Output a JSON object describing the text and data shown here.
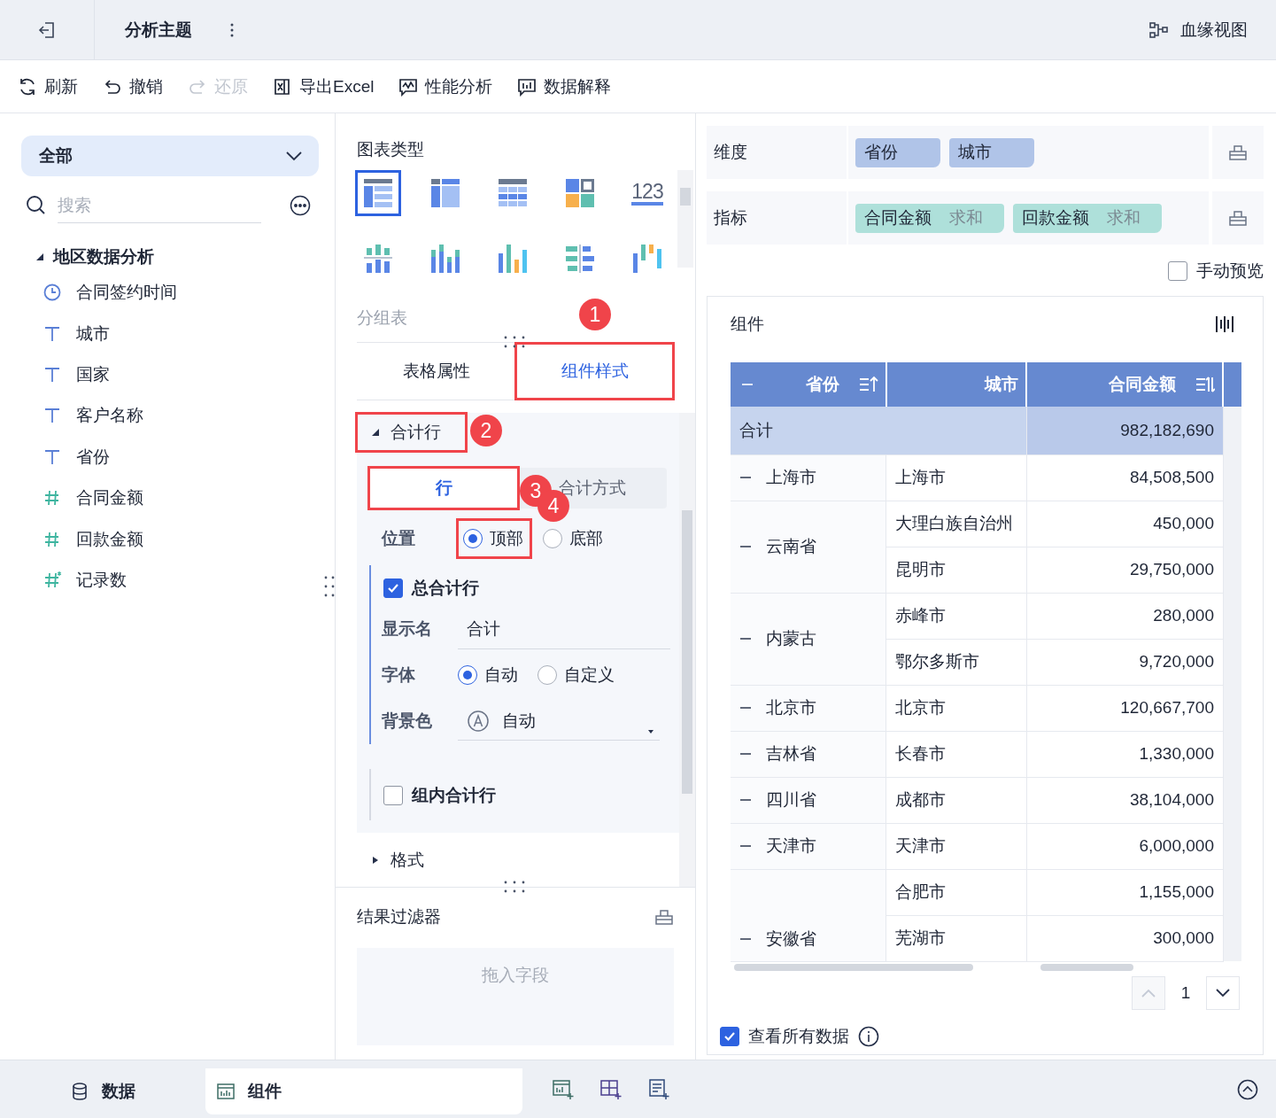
{
  "header": {
    "title": "分析主题",
    "lineage": "血缘视图"
  },
  "toolbar": [
    {
      "kind": "refresh",
      "label": "刷新",
      "disabled": false
    },
    {
      "kind": "undo",
      "label": "撤销",
      "disabled": false
    },
    {
      "kind": "redo",
      "label": "还原",
      "disabled": true
    },
    {
      "kind": "export",
      "label": "导出Excel",
      "disabled": false
    },
    {
      "kind": "performance",
      "label": "性能分析",
      "disabled": false
    },
    {
      "kind": "explain",
      "label": "数据解释",
      "disabled": false
    }
  ],
  "fields": {
    "scope": "全部",
    "search": {
      "placeholder": "搜索"
    },
    "tree": [
      {
        "label": "地区数据分析",
        "expanded": true,
        "children": [
          {
            "kind": "date",
            "label": "合同签约时间"
          },
          {
            "kind": "text",
            "label": "城市"
          },
          {
            "kind": "text",
            "label": "国家"
          },
          {
            "kind": "text",
            "label": "客户名称"
          },
          {
            "kind": "text",
            "label": "省份"
          },
          {
            "kind": "number",
            "label": "合同金额"
          },
          {
            "kind": "number",
            "label": "回款金额"
          },
          {
            "kind": "count",
            "label": "记录数"
          }
        ]
      }
    ]
  },
  "chart": {
    "heading": "图表类型",
    "caption": "分组表",
    "types": [
      {
        "kind": "group-table",
        "selected": true
      },
      {
        "kind": "cross-table",
        "selected": false
      },
      {
        "kind": "detail-table",
        "selected": false
      },
      {
        "kind": "card",
        "selected": false
      },
      {
        "kind": "kpi",
        "label": "123",
        "selected": false
      },
      {
        "kind": "split-bar",
        "selected": false
      },
      {
        "kind": "stacked-column",
        "selected": false
      },
      {
        "kind": "column",
        "selected": false
      },
      {
        "kind": "compare-bar",
        "selected": false
      },
      {
        "kind": "waterfall",
        "selected": false
      }
    ]
  },
  "tabs": [
    {
      "label": "表格属性",
      "selected": false,
      "highlighted": false
    },
    {
      "label": "组件样式",
      "selected": true,
      "highlighted": true,
      "callout": "1"
    }
  ],
  "total_rows": {
    "label": "合计行",
    "expanded": true,
    "highlighted": true,
    "callout": "2",
    "subtabs": [
      {
        "label": "行",
        "selected": true,
        "highlighted": true,
        "callout": "3"
      },
      {
        "label": "合计方式",
        "selected": false,
        "highlighted": false
      }
    ],
    "position": {
      "label": "位置",
      "callout": "4",
      "options": [
        {
          "label": "顶部",
          "selected": true
        },
        {
          "label": "底部",
          "selected": false
        }
      ]
    },
    "grand_total": {
      "label": "总合计行",
      "checked": true,
      "display_name": {
        "label": "显示名",
        "value": "合计"
      },
      "font": {
        "label": "字体",
        "options": [
          {
            "label": "自动",
            "selected": true
          },
          {
            "label": "自定义",
            "selected": false
          }
        ]
      },
      "background": {
        "label": "背景色",
        "value": "自动"
      }
    },
    "group_total": {
      "label": "组内合计行",
      "checked": false
    }
  },
  "format": {
    "label": "格式",
    "expanded": false
  },
  "result_filter": {
    "title": "结果过滤器",
    "placeholder": "拖入字段"
  },
  "dimensions": {
    "label": "维度",
    "chips": [
      {
        "name": "省份"
      },
      {
        "name": "城市"
      }
    ]
  },
  "measures": {
    "label": "指标",
    "chips": [
      {
        "name": "合同金额",
        "agg": "求和"
      },
      {
        "name": "回款金额",
        "agg": "求和"
      }
    ]
  },
  "manual_preview": {
    "label": "手动预览",
    "checked": false
  },
  "widget": {
    "title": "组件",
    "table": {
      "columns": [
        {
          "label": "省份",
          "collapse": true,
          "sortable": true,
          "ascending": true
        },
        {
          "label": "城市",
          "collapse": false,
          "sortable": false
        },
        {
          "label": "合同金额",
          "collapse": false,
          "sortable": true,
          "ascending": false
        }
      ],
      "total": {
        "label": "合计",
        "value": "982,182,690"
      },
      "groups": [
        {
          "province": "上海市",
          "rows": [
            {
              "city": "上海市",
              "amount": "84,508,500"
            }
          ]
        },
        {
          "province": "云南省",
          "rows": [
            {
              "city": "大理白族自治州",
              "amount": "450,000"
            },
            {
              "city": "昆明市",
              "amount": "29,750,000"
            }
          ]
        },
        {
          "province": "内蒙古",
          "rows": [
            {
              "city": "赤峰市",
              "amount": "280,000"
            },
            {
              "city": "鄂尔多斯市",
              "amount": "9,720,000"
            }
          ]
        },
        {
          "province": "北京市",
          "rows": [
            {
              "city": "北京市",
              "amount": "120,667,700"
            }
          ]
        },
        {
          "province": "吉林省",
          "rows": [
            {
              "city": "长春市",
              "amount": "1,330,000"
            }
          ]
        },
        {
          "province": "四川省",
          "rows": [
            {
              "city": "成都市",
              "amount": "38,104,000"
            }
          ]
        },
        {
          "province": "天津市",
          "rows": [
            {
              "city": "天津市",
              "amount": "6,000,000"
            }
          ]
        },
        {
          "province": "安徽省",
          "rows": [
            {
              "city": "合肥市",
              "amount": "1,155,000"
            },
            {
              "city": "芜湖市",
              "amount": "300,000"
            }
          ]
        }
      ]
    },
    "pagination": {
      "page": "1"
    },
    "view_all": {
      "label": "查看所有数据",
      "checked": true
    }
  },
  "bottom_tabs": [
    {
      "kind": "data",
      "label": "数据",
      "selected": false
    },
    {
      "kind": "widget",
      "label": "组件",
      "selected": true
    }
  ]
}
